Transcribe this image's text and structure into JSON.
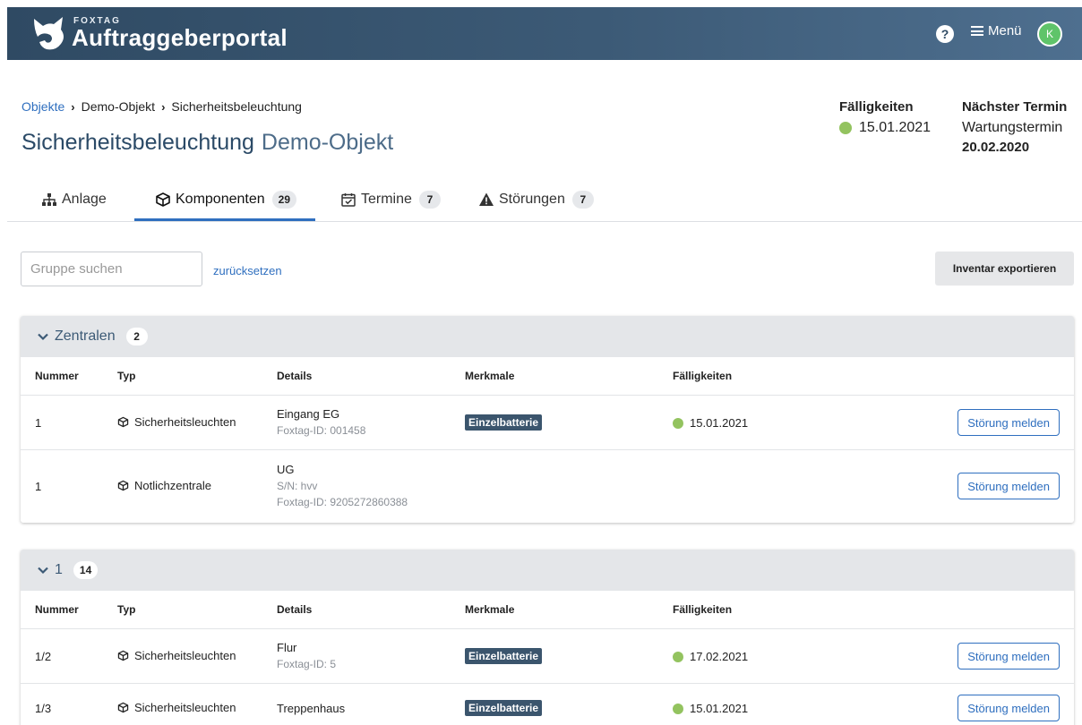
{
  "header": {
    "brand_small": "FOXTAG",
    "brand_big": "Auftraggeberportal",
    "help_icon": "question-circle-icon",
    "menu_label": "Menü",
    "avatar_initial": "K"
  },
  "breadcrumb": {
    "items": [
      "Objekte",
      "Demo-Objekt",
      "Sicherheitsbeleuchtung"
    ]
  },
  "page": {
    "title": "Sicherheitsbeleuchtung",
    "subtitle": "Demo-Objekt"
  },
  "summary": {
    "due_heading": "Fälligkeiten",
    "due_date": "15.01.2021",
    "next_heading": "Nächster Termin",
    "next_label": "Wartungstermin",
    "next_date": "20.02.2020",
    "status_color": "#93c35f"
  },
  "tabs": [
    {
      "label": "Anlage",
      "count": null,
      "icon": "sitemap-icon"
    },
    {
      "label": "Komponenten",
      "count": "29",
      "icon": "cube-icon",
      "active": true
    },
    {
      "label": "Termine",
      "count": "7",
      "icon": "calendar-check-icon"
    },
    {
      "label": "Störungen",
      "count": "7",
      "icon": "warning-icon"
    }
  ],
  "toolbar": {
    "search_placeholder": "Gruppe suchen",
    "reset_label": "zurücksetzen",
    "export_label": "Inventar exportieren"
  },
  "columns": {
    "nummer": "Nummer",
    "typ": "Typ",
    "details": "Details",
    "merkmale": "Merkmale",
    "faelligkeiten": "Fälligkeiten"
  },
  "groups": [
    {
      "name": "Zentralen",
      "count": "2",
      "rows": [
        {
          "nummer": "1",
          "typ": "Sicherheitsleuchten",
          "details": [
            "Eingang EG",
            "Foxtag-ID: 001458"
          ],
          "merkmal": "Einzelbatterie",
          "faellig": "15.01.2021",
          "action": "Störung melden"
        },
        {
          "nummer": "1",
          "typ": "Notlichzentrale",
          "details": [
            "UG",
            "S/N: hvv",
            "Foxtag-ID: 9205272860388"
          ],
          "merkmal": "",
          "faellig": "",
          "action": "Störung melden"
        }
      ]
    },
    {
      "name": "1",
      "count": "14",
      "rows": [
        {
          "nummer": "1/2",
          "typ": "Sicherheitsleuchten",
          "details": [
            "Flur",
            "Foxtag-ID: 5"
          ],
          "merkmal": "Einzelbatterie",
          "faellig": "17.02.2021",
          "action": "Störung melden"
        },
        {
          "nummer": "1/3",
          "typ": "Sicherheitsleuchten",
          "details": [
            "Treppenhaus"
          ],
          "merkmal": "Einzelbatterie",
          "faellig": "15.01.2021",
          "action": "Störung melden"
        }
      ]
    }
  ]
}
